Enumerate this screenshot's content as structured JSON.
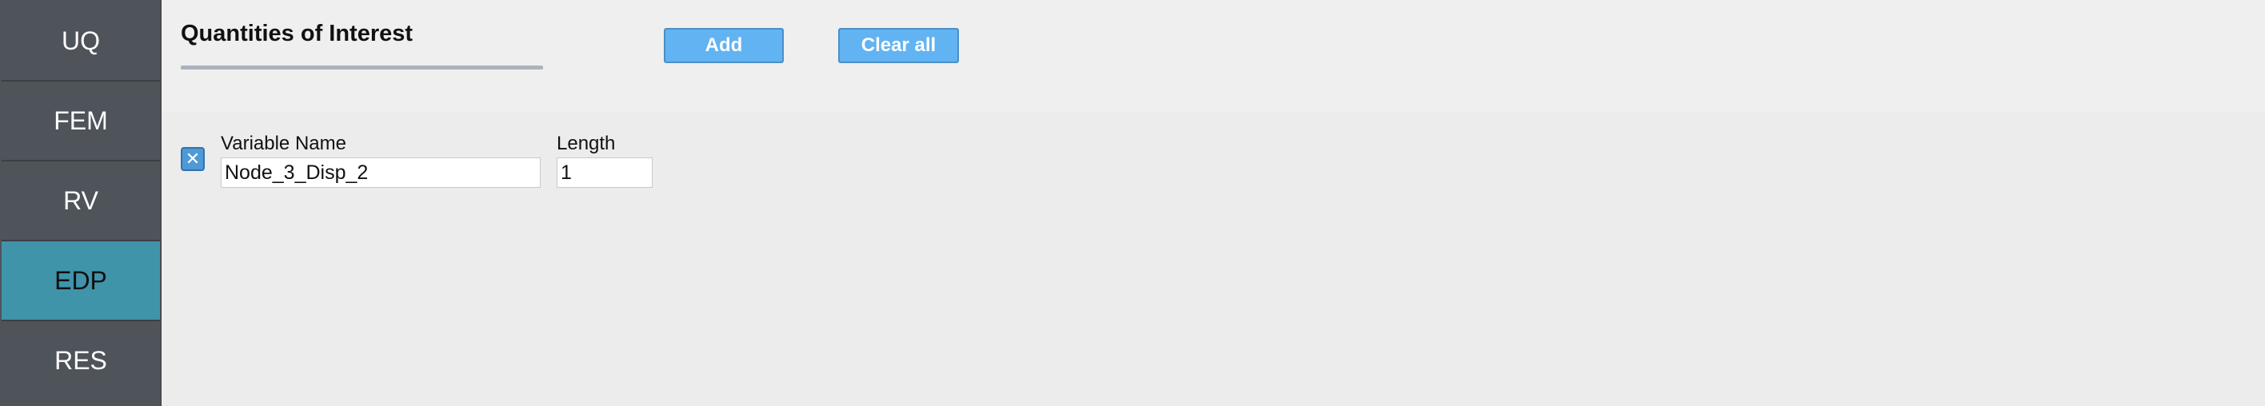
{
  "sidebar": {
    "items": [
      {
        "label": "UQ",
        "active": false
      },
      {
        "label": "FEM",
        "active": false
      },
      {
        "label": "RV",
        "active": false
      },
      {
        "label": "EDP",
        "active": true
      },
      {
        "label": "RES",
        "active": false
      }
    ]
  },
  "header": {
    "title": "Quantities of Interest",
    "add_label": "Add",
    "clear_label": "Clear all"
  },
  "qoi": {
    "remove_icon": "close-icon",
    "remove_glyph": "✕",
    "variable_name_label": "Variable Name",
    "variable_name_value": "Node_3_Disp_2",
    "length_label": "Length",
    "length_value": "1"
  },
  "colors": {
    "sidebar_bg": "#4f535a",
    "sidebar_active": "#3f94aa",
    "button_bg": "#62b3f2",
    "checkbox_bg": "#4f9ad6"
  }
}
